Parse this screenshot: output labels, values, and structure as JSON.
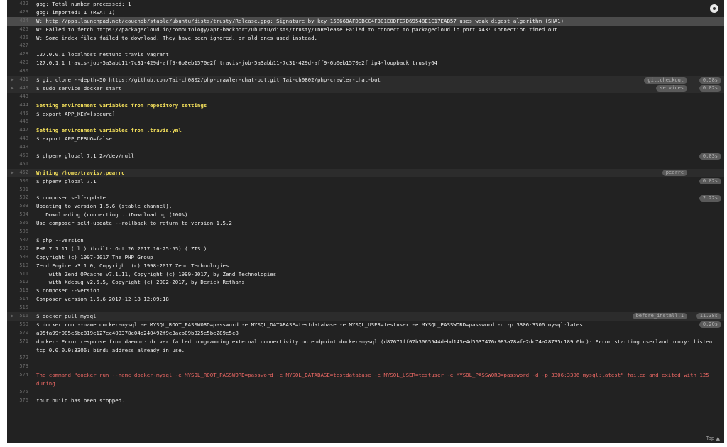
{
  "log_lines": [
    {
      "n": "422",
      "t": "gpg: Total number processed: 1"
    },
    {
      "n": "423",
      "t": "gpg:               imported: 1  (RSA: 1)"
    },
    {
      "n": "424",
      "t": "W: http://ppa.launchpad.net/couchdb/stable/ubuntu/dists/trusty/Release.gpg: Signature by key 15866BAFD9BCC4F3C1E0DFC7D69548E1C17EAB57 uses weak digest algorithm (SHA1)"
    },
    {
      "n": "425",
      "t": "W: Failed to fetch https://packagecloud.io/computology/apt-backport/ubuntu/dists/trusty/InRelease  Failed to connect to packagecloud.io port 443: Connection timed out"
    },
    {
      "n": "426",
      "t": "W: Some index files failed to download. They have been ignored, or old ones used instead."
    },
    {
      "n": "427",
      "t": ""
    },
    {
      "n": "428",
      "t": "127.0.0.1 localhost nettuno travis vagrant"
    },
    {
      "n": "429",
      "t": "127.0.1.1 travis-job-5a3abb11-7c31-429d-aff9-6b0eb1570e2f travis-job-5a3abb11-7c31-429d-aff9-6b0eb1570e2f ip4-loopback trusty64"
    },
    {
      "n": "430",
      "t": ""
    },
    {
      "n": "431",
      "t": "$ git clone --depth=50 https://github.com/Tai-ch0802/php-crawler-chat-bot.git Tai-ch0802/php-crawler-chat-bot",
      "tag": "git.checkout",
      "time": "0.58s"
    },
    {
      "n": "440",
      "t": "$ sudo service docker start",
      "tag": "services",
      "time": "0.02s"
    },
    {
      "n": "443",
      "t": ""
    },
    {
      "n": "444",
      "t": "Setting environment variables from repository settings"
    },
    {
      "n": "445",
      "t": "$ export APP_KEY=[secure]"
    },
    {
      "n": "446",
      "t": ""
    },
    {
      "n": "447",
      "t": "Setting environment variables from .travis.yml"
    },
    {
      "n": "448",
      "t": "$ export APP_DEBUG=false"
    },
    {
      "n": "449",
      "t": ""
    },
    {
      "n": "450",
      "t": "$ phpenv global 7.1 2>/dev/null",
      "time": "0.03s"
    },
    {
      "n": "451",
      "t": ""
    },
    {
      "n": "452",
      "t": "Writing /home/travis/.pearrc",
      "tag": "pearrc"
    },
    {
      "n": "500",
      "t": "$ phpenv global 7.1",
      "time": "0.02s"
    },
    {
      "n": "501",
      "t": ""
    },
    {
      "n": "502",
      "t": "$ composer self-update",
      "time": "2.22s"
    },
    {
      "n": "503",
      "t": "Updating to version 1.5.6 (stable channel)."
    },
    {
      "n": "504",
      "t": "   Downloading (connecting...)Downloading (100%)"
    },
    {
      "n": "505",
      "t": "Use composer self-update --rollback to return to version 1.5.2"
    },
    {
      "n": "506",
      "t": ""
    },
    {
      "n": "507",
      "t": "$ php --version"
    },
    {
      "n": "508",
      "t": "PHP 7.1.11 (cli) (built: Oct 26 2017 16:25:55) ( ZTS )"
    },
    {
      "n": "509",
      "t": "Copyright (c) 1997-2017 The PHP Group"
    },
    {
      "n": "510",
      "t": "Zend Engine v3.1.0, Copyright (c) 1998-2017 Zend Technologies"
    },
    {
      "n": "511",
      "t": "    with Zend OPcache v7.1.11, Copyright (c) 1999-2017, by Zend Technologies"
    },
    {
      "n": "512",
      "t": "    with Xdebug v2.5.5, Copyright (c) 2002-2017, by Derick Rethans"
    },
    {
      "n": "513",
      "t": "$ composer --version"
    },
    {
      "n": "514",
      "t": "Composer version 1.5.6 2017-12-18 12:09:18"
    },
    {
      "n": "515",
      "t": ""
    },
    {
      "n": "516",
      "t": "$ docker pull mysql",
      "tag": "before_install.1",
      "time": "11.38s"
    },
    {
      "n": "569",
      "t": "$ docker run --name docker-mysql -e MYSQL_ROOT_PASSWORD=password -e MYSQL_DATABASE=testdatabase -e MYSQL_USER=testuser -e MYSQL_PASSWORD=password -d -p 3306:3306 mysql:latest",
      "time": "0.20s"
    },
    {
      "n": "570",
      "t": "a95fa99f085e5be819e127ec403378e04d240492f9e3acb09b325e5be289e5c8"
    },
    {
      "n": "571",
      "t": "docker: Error response from daemon: driver failed programming external connectivity on endpoint docker-mysql (d87671ff07b3065544debd143e4d5637476c983a78afe2dc74a28735c189c6bc): Error starting userland proxy: listen tcp 0.0.0.0:3306: bind: address already in use."
    },
    {
      "n": "572",
      "t": ""
    },
    {
      "n": "573",
      "t": ""
    },
    {
      "n": "574",
      "t": "The command \"docker run --name docker-mysql -e MYSQL_ROOT_PASSWORD=password -e MYSQL_DATABASE=testdatabase -e MYSQL_USER=testuser -e MYSQL_PASSWORD=password -d -p 3306:3306 mysql:latest\" failed and exited with 125 during ."
    },
    {
      "n": "575",
      "t": ""
    },
    {
      "n": "576",
      "t": "Your build has been stopped."
    }
  ],
  "top_link": "Top"
}
